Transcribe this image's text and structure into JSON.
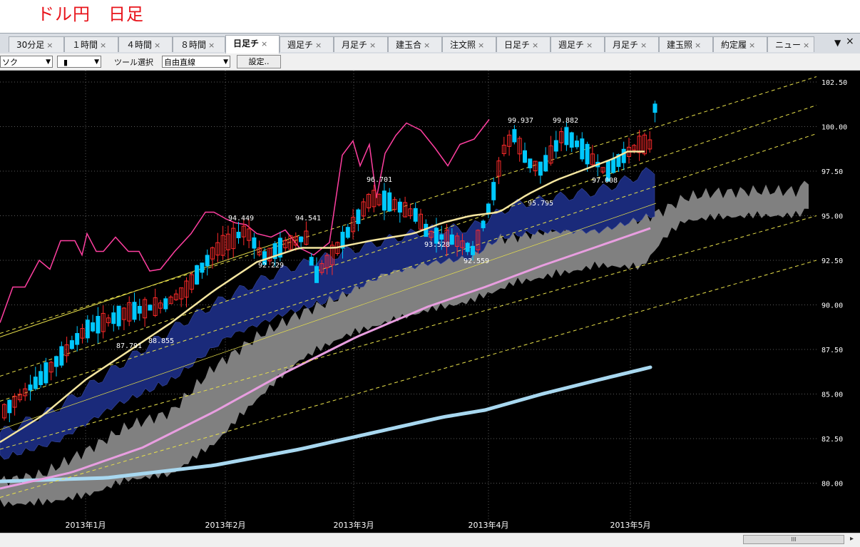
{
  "heading": "ドル円　日足",
  "tabs": [
    {
      "label": "30分足",
      "active": false
    },
    {
      "label": "１時間",
      "active": false
    },
    {
      "label": "４時間",
      "active": false
    },
    {
      "label": "８時間",
      "active": false
    },
    {
      "label": "日足チ",
      "active": true
    },
    {
      "label": "週足チ",
      "active": false
    },
    {
      "label": "月足チ",
      "active": false
    },
    {
      "label": "建玉合",
      "active": false
    },
    {
      "label": "注文照",
      "active": false
    },
    {
      "label": "日足チ",
      "active": false
    },
    {
      "label": "週足チ",
      "active": false
    },
    {
      "label": "月足チ",
      "active": false
    },
    {
      "label": "建玉照",
      "active": false
    },
    {
      "label": "約定履",
      "active": false
    },
    {
      "label": "ニュー",
      "active": false
    }
  ],
  "tab_close": "×",
  "tab_menu": "▼",
  "window_close": "×",
  "toolbar": {
    "chart_type_value": "ソク",
    "symbol_value": "▮",
    "tool_label": "ツール選択",
    "tool_value": "自由直線",
    "settings_label": "設定..",
    "dropdown_arrow": "▼"
  },
  "scrollbar": {
    "thumb_grip": "III",
    "right_arrow": "▸"
  },
  "chart_data": {
    "type": "candlestick",
    "symbol": "USD/JPY",
    "yaxis": {
      "ticks": [
        "102.50",
        "100.00",
        "97.50",
        "95.00",
        "92.50",
        "90.00",
        "87.50",
        "85.00",
        "82.50",
        "80.00"
      ],
      "range": [
        79.0,
        103.5
      ]
    },
    "xaxis": {
      "month_labels": [
        "2013年1月",
        "2013年2月",
        "2013年3月",
        "2013年4月",
        "2013年5月"
      ]
    },
    "value_labels": [
      "94.449",
      "94.541",
      "96.701",
      "99.937",
      "99.882",
      "92.229",
      "93.528",
      "95.795",
      "97.008",
      "87.791",
      "88.855",
      "92.559"
    ],
    "colors": {
      "up_candle": "#ff2a2a",
      "down_candle": "#00c8ff",
      "kumo_near": "#1a2a7a",
      "kumo_far": "#808080",
      "ma_short": "#f5e6a0",
      "ma_mid": "#e89ee0",
      "ma_long": "#a8d8f0",
      "lagging_span": "#ff3fa0",
      "channel": "#e8e04a",
      "grid": "#5a5a5a"
    }
  }
}
